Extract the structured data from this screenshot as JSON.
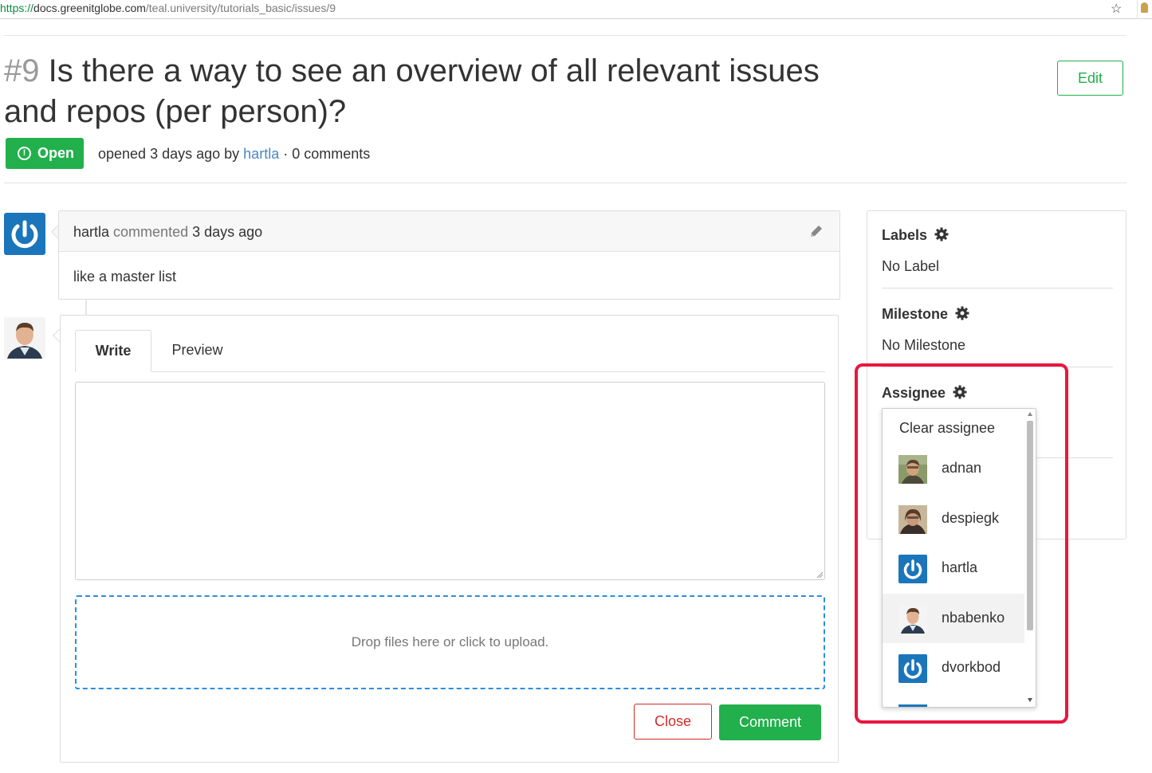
{
  "browser": {
    "url_scheme": "https://",
    "url_domain": "docs.greenitglobe.com",
    "url_path": "/teal.university/tutorials_basic/issues/9"
  },
  "issue": {
    "number": "#9",
    "title": "Is there a way to see an overview of all relevant issues and repos (per person)?",
    "edit_label": "Edit",
    "status_label": "Open",
    "meta_opened": "opened 3 days ago by",
    "meta_author": "hartla",
    "meta_comments": "· 0 comments"
  },
  "comment": {
    "author": "hartla",
    "action": "commented",
    "time": "3 days ago",
    "body": "like a master list"
  },
  "editor": {
    "tab_write": "Write",
    "tab_preview": "Preview",
    "textarea_value": "",
    "dropzone_text": "Drop files here or click to upload.",
    "close_label": "Close",
    "comment_label": "Comment"
  },
  "sidebar": {
    "labels_title": "Labels",
    "labels_value": "No Label",
    "milestone_title": "Milestone",
    "milestone_value": "No Milestone",
    "assignee_title": "Assignee"
  },
  "assignee_dropdown": {
    "clear_label": "Clear assignee",
    "items": [
      {
        "name": "adnan",
        "avatar": "photo-adnan"
      },
      {
        "name": "despiegk",
        "avatar": "photo-despiegk"
      },
      {
        "name": "hartla",
        "avatar": "power-icon"
      },
      {
        "name": "nbabenko",
        "avatar": "photo-nbabenko",
        "highlighted": true
      },
      {
        "name": "dvorkbod",
        "avatar": "power-icon"
      }
    ]
  },
  "colors": {
    "primary_green": "#21b04b",
    "danger_red": "#d12a2a",
    "link_blue": "#4a86c5",
    "avatar_blue": "#1b75bb",
    "highlight_box": "#e8173f"
  }
}
